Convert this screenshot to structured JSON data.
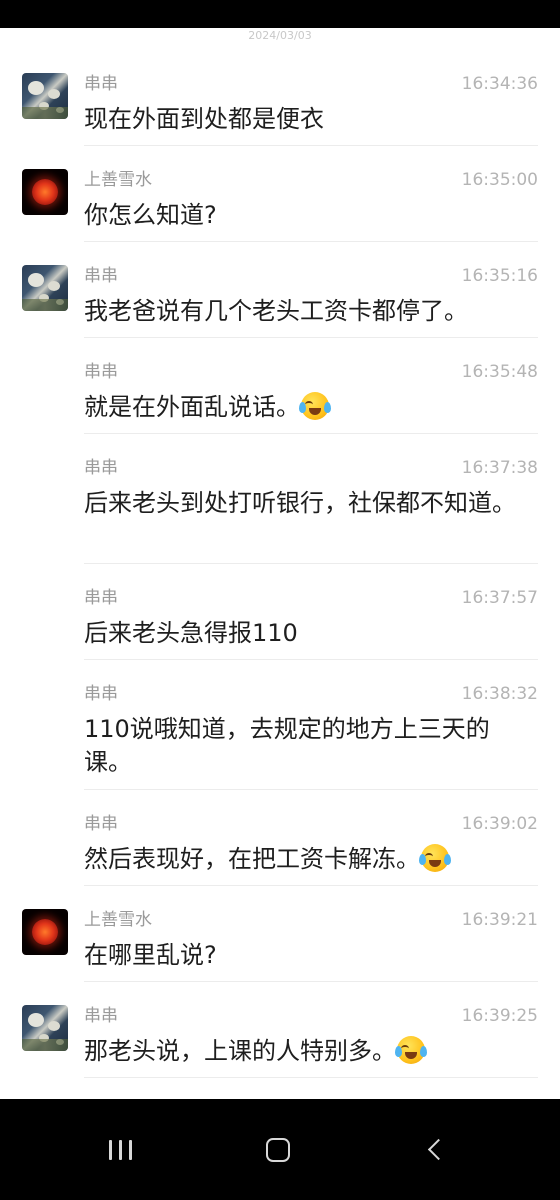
{
  "date_header": "2024/03/03",
  "messages": [
    {
      "sender": "串串",
      "avatar": "painting-avatar",
      "time": "16:34:36",
      "text": "现在外面到处都是便衣",
      "emoji": false
    },
    {
      "sender": "上善雪水",
      "avatar": "red-sun-avatar",
      "time": "16:35:00",
      "text": "你怎么知道?",
      "emoji": false
    },
    {
      "sender": "串串",
      "avatar": "painting-avatar",
      "time": "16:35:16",
      "text": "我老爸说有几个老头工资卡都停了。",
      "emoji": false
    },
    {
      "sender": "串串",
      "avatar": null,
      "time": "16:35:48",
      "text": "就是在外面乱说话。",
      "emoji": true
    },
    {
      "sender": "串串",
      "avatar": null,
      "time": "16:37:38",
      "text": "后来老头到处打听银行，社保都不知道。",
      "emoji": false
    },
    {
      "sender": "串串",
      "avatar": null,
      "time": "16:37:57",
      "text": "后来老头急得报110",
      "emoji": false
    },
    {
      "sender": "串串",
      "avatar": null,
      "time": "16:38:32",
      "text": "110说哦知道，去规定的地方上三天的课。",
      "emoji": false
    },
    {
      "sender": "串串",
      "avatar": null,
      "time": "16:39:02",
      "text": "然后表现好，在把工资卡解冻。",
      "emoji": true
    },
    {
      "sender": "上善雪水",
      "avatar": "red-sun-avatar",
      "time": "16:39:21",
      "text": "在哪里乱说?",
      "emoji": false
    },
    {
      "sender": "串串",
      "avatar": "painting-avatar",
      "time": "16:39:25",
      "text": "那老头说，上课的人特别多。",
      "emoji": true
    }
  ],
  "emoji_icon": "face-with-tears-of-joy-icon",
  "nav": {
    "recent_icon": "recent-apps-icon",
    "home_icon": "home-icon",
    "back_icon": "back-icon"
  },
  "colors": {
    "background": "#ffffff",
    "name_text": "#9a9a9a",
    "time_text": "#b4b4b4",
    "message_text": "#1e1e1e",
    "nav_bar": "#000000"
  }
}
